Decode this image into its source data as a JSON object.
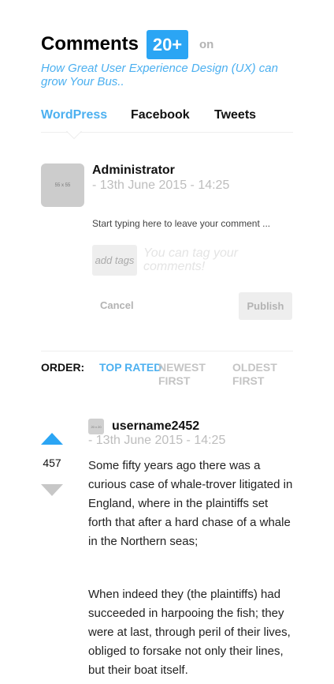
{
  "header": {
    "title": "Comments",
    "count_badge": "20+",
    "on_label": "on",
    "article_title": "How Great User Experience Design (UX) can grow Your Bus.."
  },
  "tabs": [
    {
      "label": "WordPress",
      "active": true
    },
    {
      "label": "Facebook",
      "active": false
    },
    {
      "label": "Tweets",
      "active": false
    }
  ],
  "composer": {
    "avatar_placeholder": "55 x 55",
    "author": "Administrator",
    "date": "- 13th June 2015 - 14:25",
    "input_placeholder": "Start typing here to leave your comment ...",
    "add_tags_label": "add tags",
    "tag_hint": "You can tag your comments!",
    "cancel_label": "Cancel",
    "publish_label": "Publish"
  },
  "order": {
    "label": "ORDER:",
    "options": [
      {
        "label": "TOP RATED",
        "active": true
      },
      {
        "label": "NEWEST FIRST",
        "active": false
      },
      {
        "label": "OLDEST FIRST",
        "active": false
      }
    ]
  },
  "comment": {
    "avatar_placeholder": "20 x 20",
    "username": "username2452",
    "date": "- 13th June 2015 - 14:25",
    "votes": "457",
    "paragraphs": [
      "Some fifty years ago there was a curious case of whale-trover litigated in England, where in the plaintiffs set forth that after a hard chase of a whale in the Northern seas;",
      "When indeed they (the plaintiffs) had succeeded in harpooing the fish; they were at last, through peril of their lives, obliged to forsake not only their lines, but their boat itself."
    ]
  },
  "colors": {
    "accent": "#2ba5f4",
    "link": "#4cb0f0",
    "muted": "#b3b3b3"
  }
}
